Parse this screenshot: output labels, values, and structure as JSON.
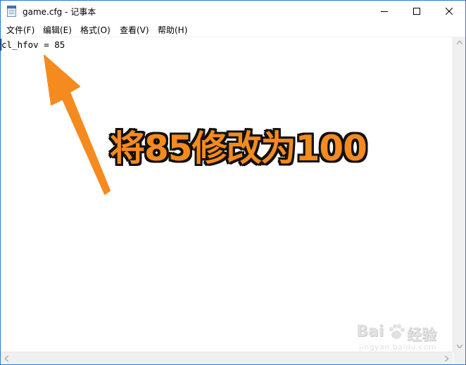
{
  "window": {
    "title": "game.cfg - 记事本",
    "controls": {
      "minimize_icon": "minimize-icon",
      "maximize_icon": "maximize-icon",
      "close_icon": "close-icon"
    }
  },
  "menu": {
    "items": [
      {
        "label": "文件(F)"
      },
      {
        "label": "编辑(E)"
      },
      {
        "label": "格式(O)"
      },
      {
        "label": "查看(V)"
      },
      {
        "label": "帮助(H)"
      }
    ]
  },
  "editor": {
    "lines": [
      "cl_hfov = 85"
    ]
  },
  "annotation": {
    "text": "将85修改为100",
    "color": "#f58a1f",
    "outline_color": "#111111"
  },
  "watermark": {
    "brand": "Bai",
    "brand_suffix": "经验",
    "url": "jingyan.baidu.com"
  },
  "colors": {
    "window_border": "#2b7bd4",
    "scrollbar": "#f0f0f0"
  }
}
